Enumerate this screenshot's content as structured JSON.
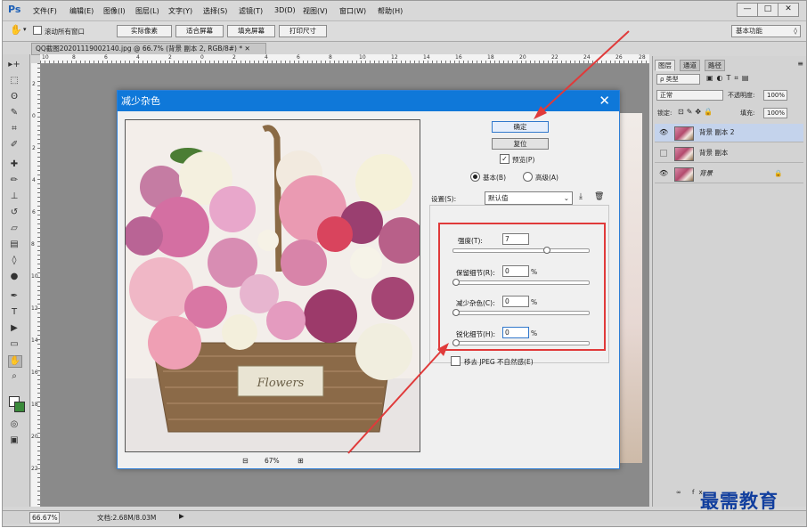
{
  "app": {
    "logo": "Ps",
    "menu": [
      "文件(F)",
      "编辑(E)",
      "图像(I)",
      "图层(L)",
      "文字(Y)",
      "选择(S)",
      "滤镜(T)",
      "3D(D)",
      "视图(V)",
      "窗口(W)",
      "帮助(H)"
    ],
    "window_buttons": [
      "—",
      "□",
      "✕"
    ]
  },
  "options_bar": {
    "checkbox_label": "滚动所有窗口",
    "buttons": [
      "实际像素",
      "适合屏幕",
      "填充屏幕",
      "打印尺寸"
    ],
    "workspace": "基本功能"
  },
  "document_tab": "QQ截图20201119002140.jpg @ 66.7% (背景 副本 2, RGB/8#) *",
  "ruler_numbers": [
    "10",
    "8",
    "6",
    "4",
    "2",
    "0",
    "2",
    "4",
    "6",
    "8",
    "10",
    "12",
    "14",
    "16",
    "18",
    "20",
    "22",
    "24",
    "26",
    "28"
  ],
  "status": {
    "zoom": "66.67%",
    "doc": "文档:2.68M/8.03M"
  },
  "panel": {
    "tabs": [
      "图层",
      "通道",
      "路径"
    ],
    "kind_label": "ρ 类型",
    "blend_mode": "正常",
    "opacity_label": "不透明度:",
    "opacity": "100%",
    "lock_label": "锁定:",
    "fill_label": "填充:",
    "fill": "100%",
    "layers": [
      {
        "name": "背景 副本 2",
        "selected": true,
        "visible": true
      },
      {
        "name": "背景 副本",
        "selected": false,
        "visible": false
      },
      {
        "name": "背景",
        "selected": false,
        "visible": true,
        "locked": true
      }
    ]
  },
  "dialog": {
    "title": "减少杂色",
    "ok": "确定",
    "reset": "复位",
    "preview_label": "预览(P)",
    "preview_checked": true,
    "mode_basic": "基本(B)",
    "mode_advanced": "高级(A)",
    "mode": "basic",
    "settings_label": "设置(S):",
    "settings_value": "默认值",
    "zoom": "67%",
    "zoom_out": "⊟",
    "zoom_in": "⊞",
    "preview_caption": "Flowers",
    "sliders": [
      {
        "label": "强度(T):",
        "value": "7",
        "unit": "",
        "level": 0.7
      },
      {
        "label": "保留细节(R):",
        "value": "0",
        "unit": "%",
        "level": 0.0
      },
      {
        "label": "减少杂色(C):",
        "value": "0",
        "unit": "%",
        "level": 0.0
      },
      {
        "label": "锐化细节(H):",
        "value": "0",
        "unit": "%",
        "level": 0.0
      }
    ],
    "jpeg_label": "移去 JPEG 不自然感(E)",
    "jpeg_checked": false
  },
  "watermark": "最需教育",
  "colors": {
    "title_bar": "#0f78d9",
    "highlight": "#e03a3a",
    "selected_layer": "#c4d3ec"
  }
}
